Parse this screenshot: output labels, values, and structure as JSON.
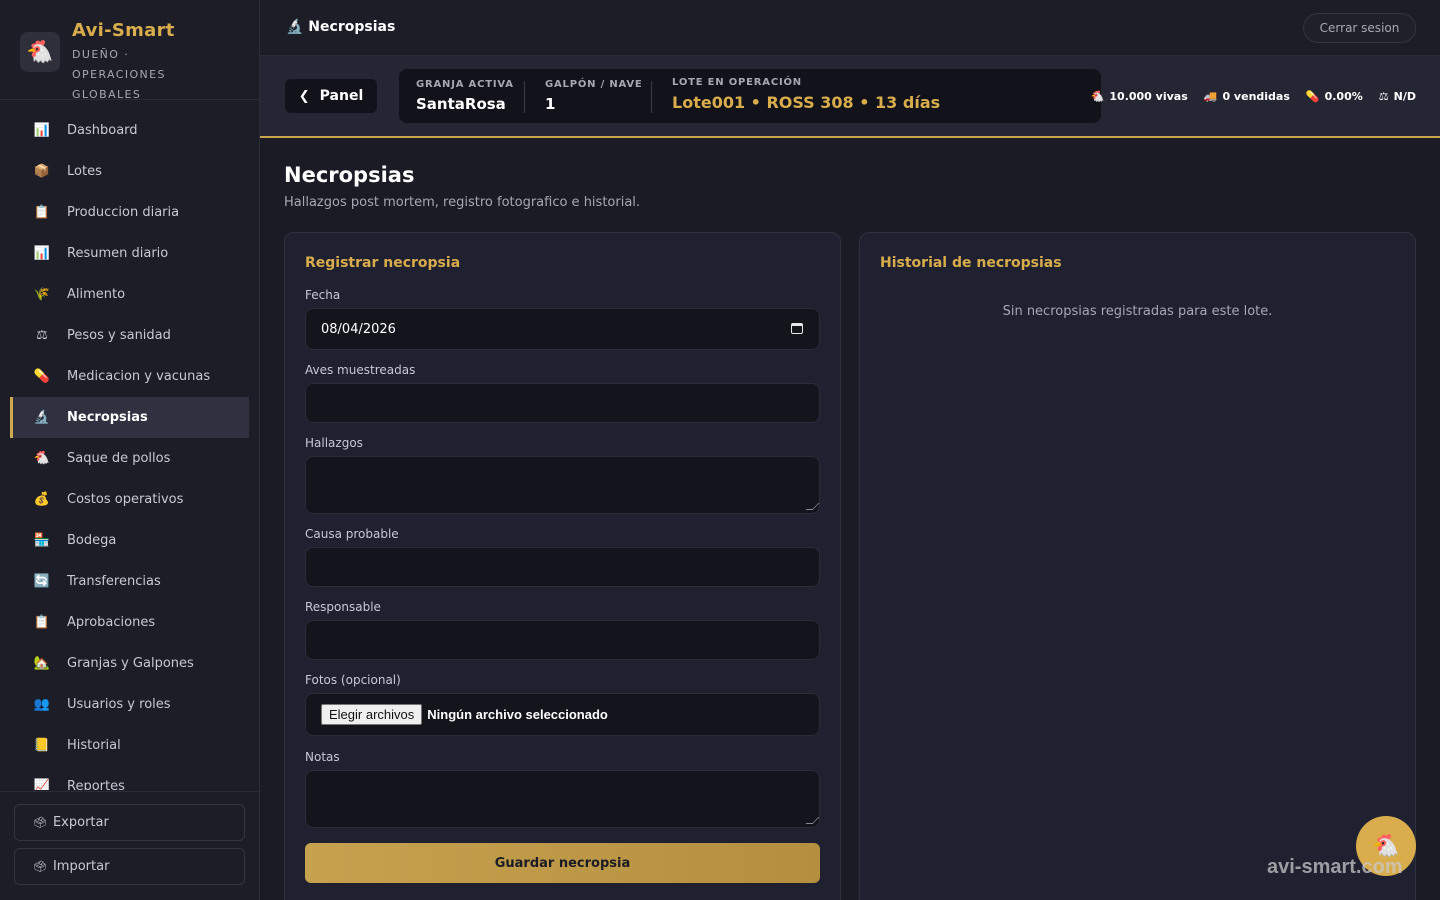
{
  "brand": {
    "name": "Avi-Smart",
    "role": "DUEÑO · OPERACIONES GLOBALES",
    "logo": "🐔"
  },
  "sidebar": {
    "items": [
      {
        "label": "Dashboard",
        "icon": "📊"
      },
      {
        "label": "Lotes",
        "icon": "📦"
      },
      {
        "label": "Produccion diaria",
        "icon": "📋"
      },
      {
        "label": "Resumen diario",
        "icon": "📊"
      },
      {
        "label": "Alimento",
        "icon": "🌾"
      },
      {
        "label": "Pesos y sanidad",
        "icon": "⚖"
      },
      {
        "label": "Medicacion y vacunas",
        "icon": "💊"
      },
      {
        "label": "Necropsias",
        "icon": "🔬"
      },
      {
        "label": "Saque de pollos",
        "icon": "🐔"
      },
      {
        "label": "Costos operativos",
        "icon": "💰"
      },
      {
        "label": "Bodega",
        "icon": "🏪"
      },
      {
        "label": "Transferencias",
        "icon": "🔄"
      },
      {
        "label": "Aprobaciones",
        "icon": "📋"
      },
      {
        "label": "Granjas y Galpones",
        "icon": "🏡"
      },
      {
        "label": "Usuarios y roles",
        "icon": "👥"
      },
      {
        "label": "Historial",
        "icon": "📒"
      },
      {
        "label": "Reportes",
        "icon": "📈"
      }
    ],
    "active_index": 7,
    "export_label": "Exportar",
    "import_label": "Importar"
  },
  "topbar": {
    "title": "🔬 Necropsias",
    "logout_label": "Cerrar sesion"
  },
  "context": {
    "panel_label": "Panel",
    "farm_label": "GRANJA ACTIVA",
    "farm_value": "SantaRosa",
    "house_label": "GALPÓN / NAVE",
    "house_value": "1",
    "lot_label": "LOTE EN OPERACIÓN",
    "lot_value": "Lote001 • ROSS 308 • 13 días",
    "stats": [
      {
        "icon": "🐔",
        "text": "10.000 vivas"
      },
      {
        "icon": "🚚",
        "text": "0 vendidas"
      },
      {
        "icon": "💊",
        "text": "0.00%"
      },
      {
        "icon": "⚖",
        "text": "N/D"
      }
    ]
  },
  "page": {
    "title": "Necropsias",
    "subtitle": "Hallazgos post mortem, registro fotografico e historial."
  },
  "form": {
    "title": "Registrar necropsia",
    "date_label": "Fecha",
    "date_value": "08/04/2026",
    "birds_label": "Aves muestreadas",
    "findings_label": "Hallazgos",
    "cause_label": "Causa probable",
    "responsible_label": "Responsable",
    "photos_label": "Fotos (opcional)",
    "file_button": "Elegir archivos",
    "file_status": "Ningún archivo seleccionado",
    "notes_label": "Notas",
    "save_label": "Guardar necropsia"
  },
  "history": {
    "title": "Historial de necropsias",
    "empty": "Sin necropsias registradas para este lote."
  },
  "fab_icon": "🐔",
  "watermark": "avi-smart.com",
  "colors": {
    "accent": "#d9ad4c",
    "background": "#1a1b24",
    "card": "#1f2030"
  }
}
